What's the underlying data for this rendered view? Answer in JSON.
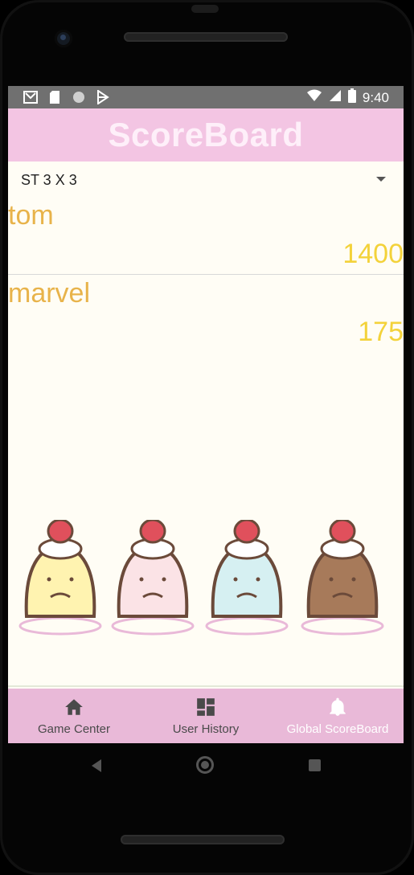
{
  "status_bar": {
    "time": "9:40",
    "left_icons": [
      "gmail-icon",
      "sd-card-icon",
      "circle-icon",
      "play-store-icon"
    ],
    "right_icons": [
      "wifi-icon",
      "signal-icon",
      "battery-icon"
    ]
  },
  "app_bar": {
    "title": "ScoreBoard"
  },
  "filter": {
    "selected": "ST 3 X 3"
  },
  "scores": [
    {
      "name": "tom",
      "score": "1400"
    },
    {
      "name": "marvel",
      "score": "175"
    }
  ],
  "bottom_nav": {
    "items": [
      {
        "label": "Game Center",
        "icon": "home-icon",
        "active": false
      },
      {
        "label": "User History",
        "icon": "dashboard-icon",
        "active": false
      },
      {
        "label": "Global ScoreBoard",
        "icon": "bell-icon",
        "active": true
      }
    ]
  },
  "colors": {
    "app_bar": "#f3c5e3",
    "bottom_nav": "#e9b9d8",
    "name_text": "#e8b34a",
    "score_text": "#f3d23a",
    "background": "#fffdf5"
  }
}
